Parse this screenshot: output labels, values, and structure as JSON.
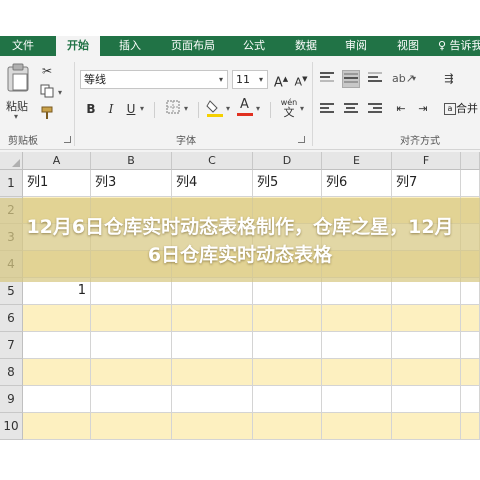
{
  "ribbon_tabs": [
    "文件",
    "开始",
    "插入",
    "页面布局",
    "公式",
    "数据",
    "审阅",
    "视图",
    "♀ 告诉我"
  ],
  "clipboard": {
    "paste_label": "粘贴",
    "group_label": "剪贴板"
  },
  "font": {
    "name": "等线",
    "size": "11",
    "grow_glyph": "A",
    "shrink_glyph": "A",
    "bold": "B",
    "italic": "I",
    "underline": "U",
    "font_color_glyph": "A",
    "phonetic_glyph": "wén",
    "group_label": "字体"
  },
  "alignment": {
    "group_label": "对齐方式",
    "merge_label": "合并"
  },
  "sheet": {
    "columns": [
      "A",
      "B",
      "C",
      "D",
      "E",
      "F"
    ],
    "rows": [
      {
        "num": "1",
        "cells": [
          "列1",
          "列3",
          "列4",
          "列5",
          "列6",
          "列7"
        ]
      },
      {
        "num": "2",
        "cells": [
          "",
          "",
          "",
          "",
          "",
          ""
        ]
      },
      {
        "num": "3",
        "cells": [
          "",
          "",
          "",
          "",
          "",
          ""
        ]
      },
      {
        "num": "4",
        "cells": [
          "",
          "",
          "",
          "",
          "",
          ""
        ]
      },
      {
        "num": "5",
        "cells": [
          "1",
          "",
          "",
          "",
          "",
          ""
        ]
      },
      {
        "num": "6",
        "cells": [
          "",
          "",
          "",
          "",
          "",
          ""
        ]
      },
      {
        "num": "7",
        "cells": [
          "",
          "",
          "",
          "",
          "",
          ""
        ]
      },
      {
        "num": "8",
        "cells": [
          "",
          "",
          "",
          "",
          "",
          ""
        ]
      },
      {
        "num": "9",
        "cells": [
          "",
          "",
          "",
          "",
          "",
          ""
        ]
      },
      {
        "num": "10",
        "cells": [
          "",
          "",
          "",
          "",
          "",
          ""
        ]
      }
    ]
  },
  "banner": {
    "title": "12月6日仓库实时动态表格制作，仓库之星，12月6日仓库实时动态表格"
  },
  "colors": {
    "ribbon_green": "#217346",
    "ribbon_bg": "#f3f3f3",
    "band_yellow": "#fdf0c0",
    "band_white": "#ffffff",
    "banner_overlay": "#d7c882",
    "fill_yellow": "#f5d000",
    "font_red": "#e03020"
  },
  "icons": [
    "scissors-icon",
    "copy-icon",
    "format-painter-icon",
    "paste-icon",
    "border-icon",
    "fill-color-icon",
    "font-color-icon",
    "phonetic-icon",
    "align-top-icon",
    "align-middle-icon",
    "align-bottom-icon",
    "align-left-icon",
    "align-center-icon",
    "align-right-icon",
    "indent-decrease-icon",
    "indent-increase-icon",
    "orientation-icon",
    "wrap-text-icon",
    "merge-center-icon",
    "tell-me-icon"
  ]
}
